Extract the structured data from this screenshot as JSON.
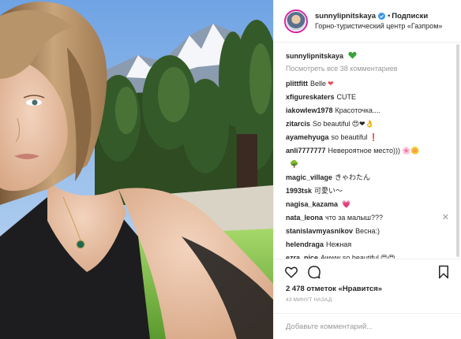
{
  "post": {
    "username": "sunnylipnitskaya",
    "follow_separator": "•",
    "follow_label": "Подписки",
    "location": "Горно-туристический центр «Газпром»",
    "caption_user": "sunnylipnitskaya",
    "caption_icon": "green-heart-icon",
    "view_all_comments": "Посмотреть все 38 комментариев",
    "likes": "2 478 отметок «Нравится»",
    "timestamp": "43 МИНУТ НАЗАД",
    "comment_placeholder": "Добавьте комментарий..."
  },
  "comments": [
    {
      "user": "plittfitt",
      "text": "Belle",
      "emoji": "❤"
    },
    {
      "user": "xfigureskaters",
      "text": "CUTE",
      "emoji": ""
    },
    {
      "user": "iakowlew1978",
      "text": "Красоточка....",
      "emoji": ""
    },
    {
      "user": "zitarcis",
      "text": "So beautiful",
      "emoji": "😍❤👌"
    },
    {
      "user": "ayamehyuga",
      "text": "so beautiful",
      "emoji": "❗"
    },
    {
      "user": "anli7777777",
      "text": "Невероятное место)))",
      "emoji": "🌸🌼"
    },
    {
      "user": "",
      "text": "",
      "emoji": "🌳"
    },
    {
      "user": "magic_village",
      "text": "きゃわたん",
      "emoji": ""
    },
    {
      "user": "1993tsk",
      "text": "可愛い〜",
      "emoji": ""
    },
    {
      "user": "nagisa_kazama",
      "text": "",
      "emoji": "💗"
    },
    {
      "user": "nata_leona",
      "text": "что за малыш???",
      "emoji": ""
    },
    {
      "user": "stanislavmyasnikov",
      "text": "Весна:)",
      "emoji": ""
    },
    {
      "user": "helendraga",
      "text": "Нежная",
      "emoji": ""
    },
    {
      "user": "ezra_nice",
      "text": "Awww so beautiful",
      "emoji": "😍😍"
    }
  ],
  "comment_close_symbol": "✕",
  "colors": {
    "accent_heart": "#ed4956",
    "verified_blue": "#3897f0",
    "muted_text": "#999999",
    "text": "#262626",
    "border": "#efefef"
  },
  "icons": {
    "like": "heart-outline-icon",
    "comment": "speech-bubble-icon",
    "save": "bookmark-icon",
    "verified": "verified-badge-icon"
  }
}
